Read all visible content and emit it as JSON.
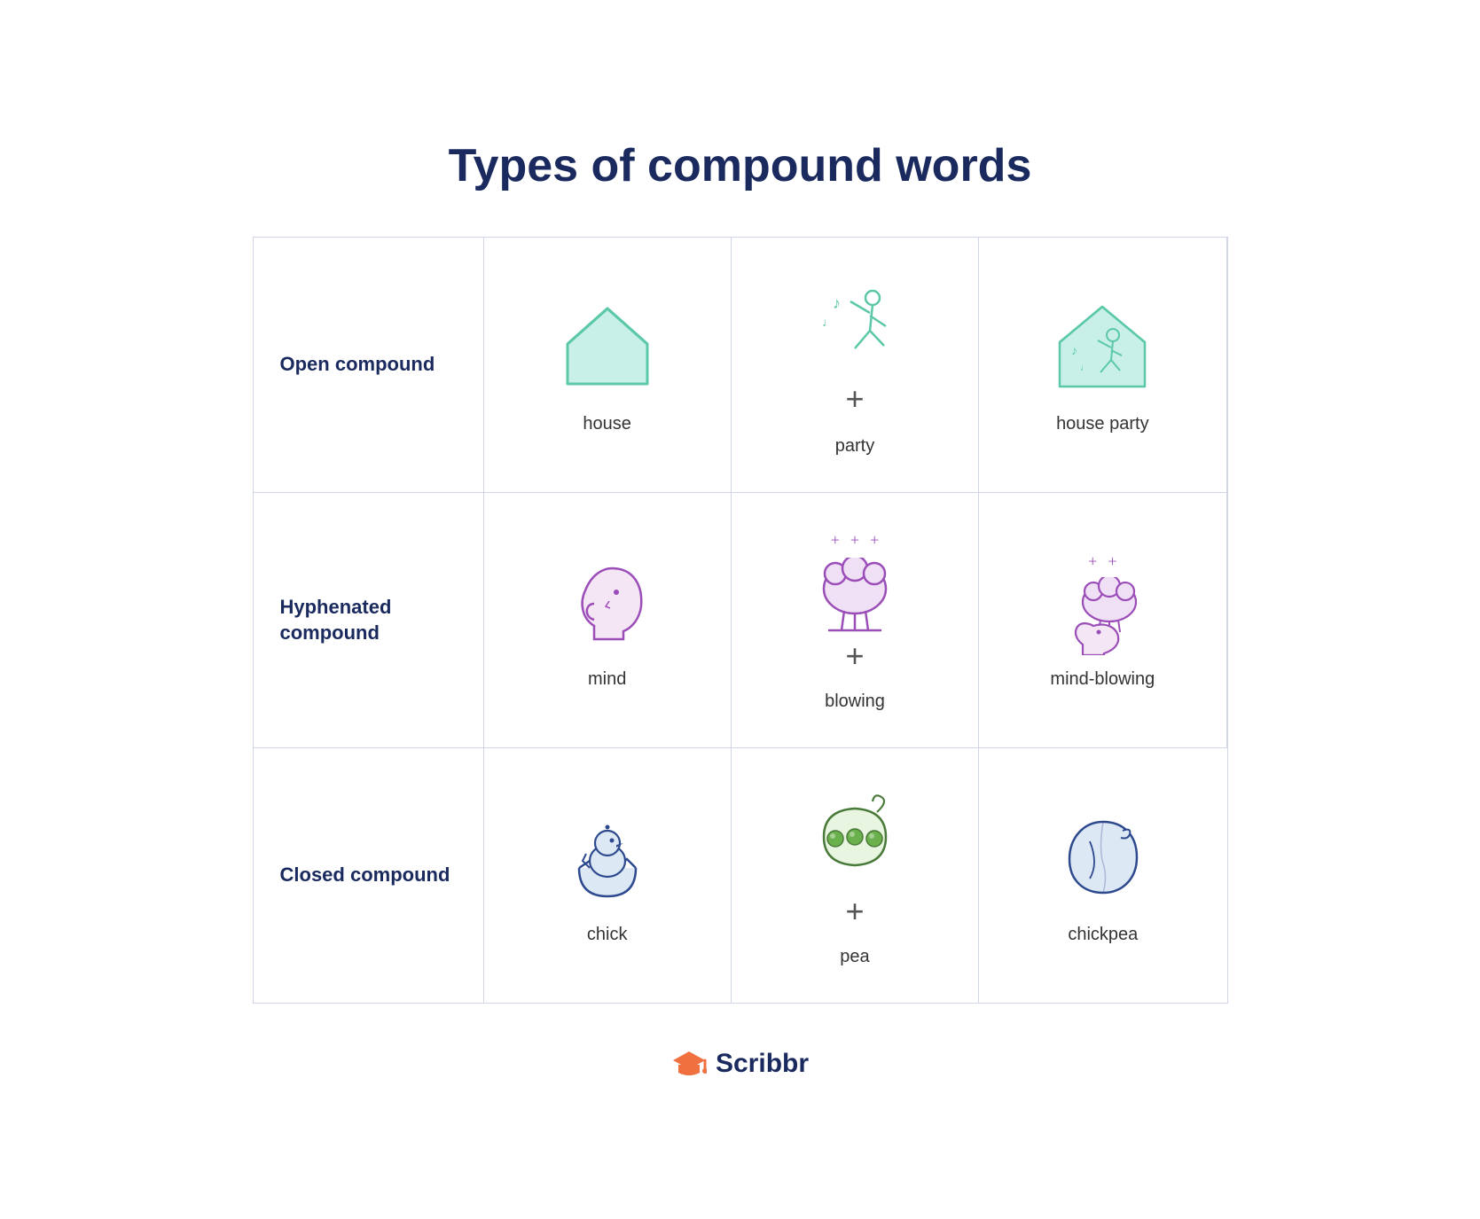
{
  "title": "Types of compound words",
  "rows": [
    {
      "label": "Open compound",
      "word1": "house",
      "word2": "party",
      "result": "house party",
      "type": "open"
    },
    {
      "label": "Hyphenated compound",
      "word1": "mind",
      "word2": "blowing",
      "result": "mind-blowing",
      "type": "hyphenated"
    },
    {
      "label": "Closed compound",
      "word1": "chick",
      "word2": "pea",
      "result": "chickpea",
      "type": "closed"
    }
  ],
  "footer": {
    "brand": "Scribbr"
  }
}
